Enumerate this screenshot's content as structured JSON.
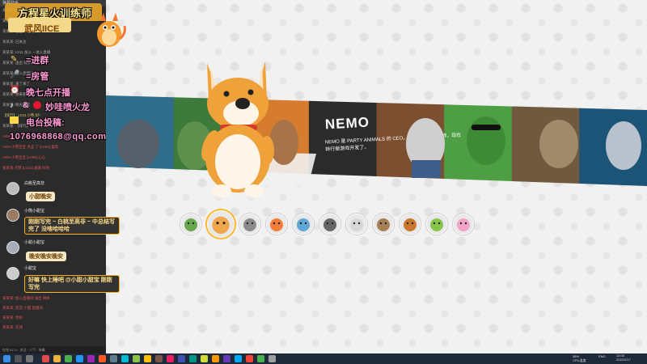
{
  "stream_overlay": {
    "banner_title": "方程星火训练师",
    "streamer_name": "武风IICE",
    "join_group_label": "=进群",
    "room_manager_label": "=房管",
    "schedule_text": "晚七点开播",
    "platform_handle": "妙哇喷火龙",
    "submission_label": "电台投稿:",
    "email": "1076968868@qq.com"
  },
  "chat": {
    "header": "弹幕助手",
    "lines": [
      {
        "text": "某某某: 加入直播间",
        "style": "gray"
      },
      {
        "text": "某某某: LV42 欢迎进入直播间",
        "style": "gray"
      },
      {
        "text": "某某某: 送出 小心心 x1",
        "style": "gray"
      },
      {
        "text": "某某某: 已关注",
        "style": "gray"
      },
      {
        "text": "某某某: LV11 加入 ~ 进入直播",
        "style": "gray"
      },
      {
        "text": "某某某: 送出 辣条",
        "style": "gray"
      },
      {
        "text": "某某某: 加入直播间",
        "style": "gray"
      },
      {
        "text": "某某某: 来了来了",
        "style": "gray"
      },
      {
        "text": "某某某: 进来看看",
        "style": "gray"
      },
      {
        "text": "某某某: 明天就是",
        "style": "gray"
      },
      {
        "text": "【排行】 LV24 小熊 好!",
        "style": "yel"
      },
      {
        "text": "某某某: 【排行】 LV24 小熊 好的",
        "style": "gray"
      },
      {
        "text": "AXM 小熊宝宝 送出(LV48) 心心",
        "style": "red"
      },
      {
        "text": "AXM 小熊宝宝 点击 了 [LV50] 喜欢",
        "style": "red"
      },
      {
        "text": "AXM 小熊宝宝 [LV58] 心心",
        "style": "red"
      },
      {
        "text": "某某某 点赞 [LV14] 满满 好的",
        "style": "red"
      }
    ],
    "bubbles": [
      {
        "user": "白桃至高非",
        "text": "小甜晚安"
      },
      {
        "user": "小熊小甜宝",
        "text": "刚刚写完 ~ 白桃至高非 ~ 中总结写完了 没啥哈哈哈"
      },
      {
        "user": "小甜小甜宝",
        "text": "晚安晚安晚安"
      },
      {
        "user": "小甜宝",
        "text": "好嘛 快上睡吧 @小甜小甜宝 刚刚写完"
      }
    ],
    "bottom_lines": [
      {
        "text": "某某某: 加入直播间 送出 辣条",
        "style": "red"
      },
      {
        "text": "某某某: 欢迎 小甜 直播间",
        "style": "red"
      },
      {
        "text": "某某某: 你好",
        "style": "red"
      },
      {
        "text": "某某某: 在线",
        "style": "red"
      }
    ],
    "footer": "在线 6174 · 关注 · 人气 · 弹幕"
  },
  "banner": {
    "character_name": "NEMO",
    "description": "NEMO 是 PARTY ANIMALS 的 CEO。他以前是猫设计师，现在转行做游戏开发了。",
    "panel_colors": [
      "#2f6d8a",
      "#3d7a3c",
      "#d67c2e",
      "#2b2b2b",
      "#7b4f2f",
      "#4e9f43",
      "#6f5a3f",
      "#1b5477"
    ]
  },
  "selector": {
    "characters": [
      {
        "name": "鳄鱼",
        "color": "#6aa84f"
      },
      {
        "name": "柯基",
        "color": "#f0a64a",
        "active": true
      },
      {
        "name": "狼",
        "color": "#8b8b8b"
      },
      {
        "name": "狐狸",
        "color": "#f27c3a"
      },
      {
        "name": "河马",
        "color": "#5fa7d6"
      },
      {
        "name": "狗",
        "color": "#666666"
      },
      {
        "name": "羊",
        "color": "#d6d6d6"
      },
      {
        "name": "水獭",
        "color": "#a57f55"
      },
      {
        "name": "小熊",
        "color": "#c9782f"
      },
      {
        "name": "青蛙",
        "color": "#86c44a"
      },
      {
        "name": "兔子",
        "color": "#f3a3c7"
      }
    ]
  },
  "taskbar": {
    "time": "12:00",
    "date": "2022/2/17",
    "lang": "ENG",
    "cpu_text": "38%\nCPU温度"
  }
}
